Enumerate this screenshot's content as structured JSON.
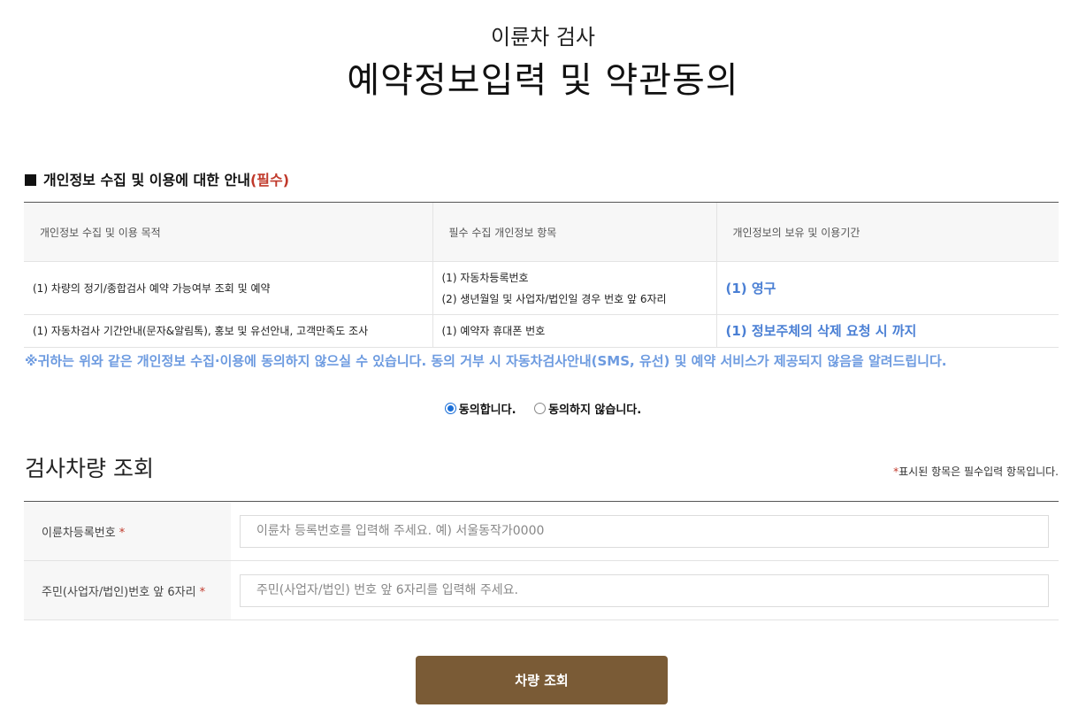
{
  "header": {
    "subtitle": "이륜차 검사",
    "title": "예약정보입력 및 약관동의"
  },
  "privacy": {
    "heading": "개인정보 수집 및 이용에 대한 안내",
    "heading_required": "(필수)",
    "columns": [
      "개인정보 수집 및 이용 목적",
      "필수 수집 개인정보 항목",
      "개인정보의 보유 및 이용기간"
    ],
    "rows": [
      {
        "purpose": "(1) 차량의 정기/종합검사 예약 가능여부 조회 및 예약",
        "items": [
          "(1) 자동차등록번호",
          "(2) 생년월일 및 사업자/법인일 경우 번호 앞 6자리"
        ],
        "period": "(1) 영구"
      },
      {
        "purpose": "(1) 자동차검사 기간안내(문자&알림톡), 홍보 및 유선안내, 고객만족도 조사",
        "items": [
          "(1) 예약자 휴대폰 번호"
        ],
        "period": "(1) 정보주체의 삭제 요청 시 까지"
      }
    ],
    "notice": "※귀하는 위와 같은 개인정보 수집·이용에 동의하지 않으실 수 있습니다. 동의 거부 시 자동차검사안내(SMS, 유선) 및 예약 서비스가 제공되지 않음을 알려드립니다.",
    "notice_color": "#6d9be0"
  },
  "consent": {
    "agree_label": "동의합니다.",
    "disagree_label": "동의하지 않습니다.",
    "selected": "agree"
  },
  "lookup": {
    "title": "검사차량 조회",
    "required_note_star": "*",
    "required_note": "표시된 항목은 필수입력 항목입니다.",
    "fields": [
      {
        "label": "이륜차등록번호",
        "required_mark": "*",
        "placeholder": "이륜차 등록번호를 입력해 주세요. 예) 서울동작가0000",
        "value": ""
      },
      {
        "label": "주민(사업자/법인)번호 앞 6자리",
        "required_mark": "*",
        "placeholder": "주민(사업자/법인) 번호 앞 6자리를 입력해 주세요.",
        "value": ""
      }
    ],
    "button_label": "차량 조회",
    "button_color": "#7a5b36"
  }
}
